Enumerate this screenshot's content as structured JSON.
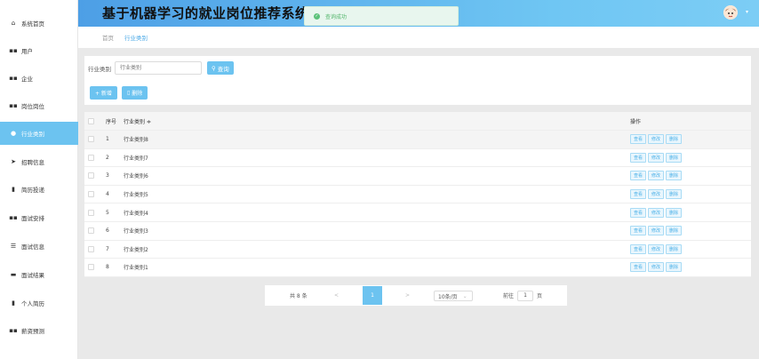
{
  "app": {
    "title": "基于机器学习的就业岗位推荐系统"
  },
  "toast": {
    "message": "查询成功"
  },
  "sidebar": {
    "items": [
      {
        "label": "系统首页",
        "icon": "home-icon",
        "glyph": "⌂",
        "active": false
      },
      {
        "label": "用户",
        "icon": "grid-icon",
        "glyph": "▪▪",
        "active": false
      },
      {
        "label": "企业",
        "icon": "grid-icon",
        "glyph": "▪▪",
        "active": false
      },
      {
        "label": "岗位岗位",
        "icon": "grid-icon",
        "glyph": "▪▪",
        "active": false
      },
      {
        "label": "行业类别",
        "icon": "location-icon",
        "glyph": "●",
        "active": true
      },
      {
        "label": "招聘信息",
        "icon": "send-icon",
        "glyph": "➤",
        "active": false
      },
      {
        "label": "简历投递",
        "icon": "bar-chart-icon",
        "glyph": "▮",
        "active": false
      },
      {
        "label": "面试安排",
        "icon": "grid-icon",
        "glyph": "▪▪",
        "active": false
      },
      {
        "label": "面试信息",
        "icon": "sliders-icon",
        "glyph": "☰",
        "active": false
      },
      {
        "label": "面试结果",
        "icon": "tablet-icon",
        "glyph": "▬",
        "active": false
      },
      {
        "label": "个人简历",
        "icon": "phone-icon",
        "glyph": "▮",
        "active": false
      },
      {
        "label": "薪资预测",
        "icon": "grid-icon",
        "glyph": "▪▪",
        "active": false
      }
    ]
  },
  "breadcrumb": {
    "home": "首页",
    "current": "行业类别"
  },
  "search": {
    "label": "行业类别",
    "placeholder": "行业类别",
    "button": "查询",
    "button_icon": "search-icon"
  },
  "actions": {
    "add": "+ 新增",
    "delete": "删除"
  },
  "table": {
    "headers": {
      "index": "序号",
      "name": "行业类别 ≑",
      "ops": "操作"
    },
    "rows": [
      {
        "index": "1",
        "name": "行业类别8"
      },
      {
        "index": "2",
        "name": "行业类别7"
      },
      {
        "index": "3",
        "name": "行业类别6"
      },
      {
        "index": "4",
        "name": "行业类别5"
      },
      {
        "index": "5",
        "name": "行业类别4"
      },
      {
        "index": "6",
        "name": "行业类别3"
      },
      {
        "index": "7",
        "name": "行业类别2"
      },
      {
        "index": "8",
        "name": "行业类别1"
      }
    ],
    "row_ops": [
      "查看",
      "修改",
      "删除"
    ]
  },
  "pagination": {
    "total": "共 8 条",
    "prev": "<",
    "current": "1",
    "next": ">",
    "page_size": "10条/页",
    "goto_label": "前往",
    "goto_value": "1",
    "page_unit": "页"
  },
  "colors": {
    "accent": "#6cc3f0",
    "header_start": "#4d9fe6",
    "toast_bg": "#e8f6ee"
  }
}
